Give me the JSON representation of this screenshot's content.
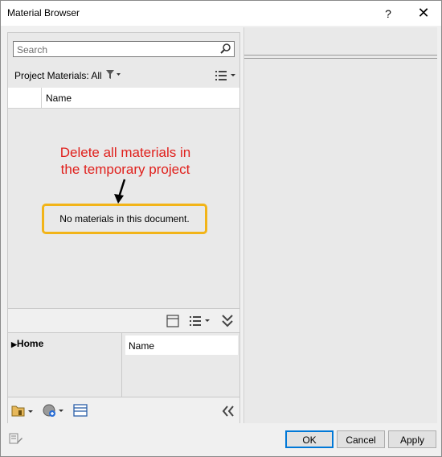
{
  "window": {
    "title": "Material Browser",
    "help_label": "?",
    "close_label": "✕"
  },
  "search": {
    "placeholder": "Search"
  },
  "project": {
    "label": "Project Materials: All"
  },
  "list": {
    "column_header": "Name",
    "empty_text": "No materials in this document."
  },
  "annotation": {
    "line1": "Delete all materials in",
    "line2": "the temporary project",
    "color": "#e0201c",
    "highlight_color": "#f2b418"
  },
  "library_tree": {
    "root": "Home",
    "column_header": "Name"
  },
  "buttons": {
    "ok": "OK",
    "cancel": "Cancel",
    "apply": "Apply"
  },
  "icons": [
    "search-icon",
    "filter-icon",
    "list-view-icon",
    "panel-toggle-icon",
    "expand-chevrons-icon",
    "library-folder-icon",
    "create-material-icon",
    "material-editor-icon",
    "collapse-left-icon",
    "edit-icon"
  ]
}
